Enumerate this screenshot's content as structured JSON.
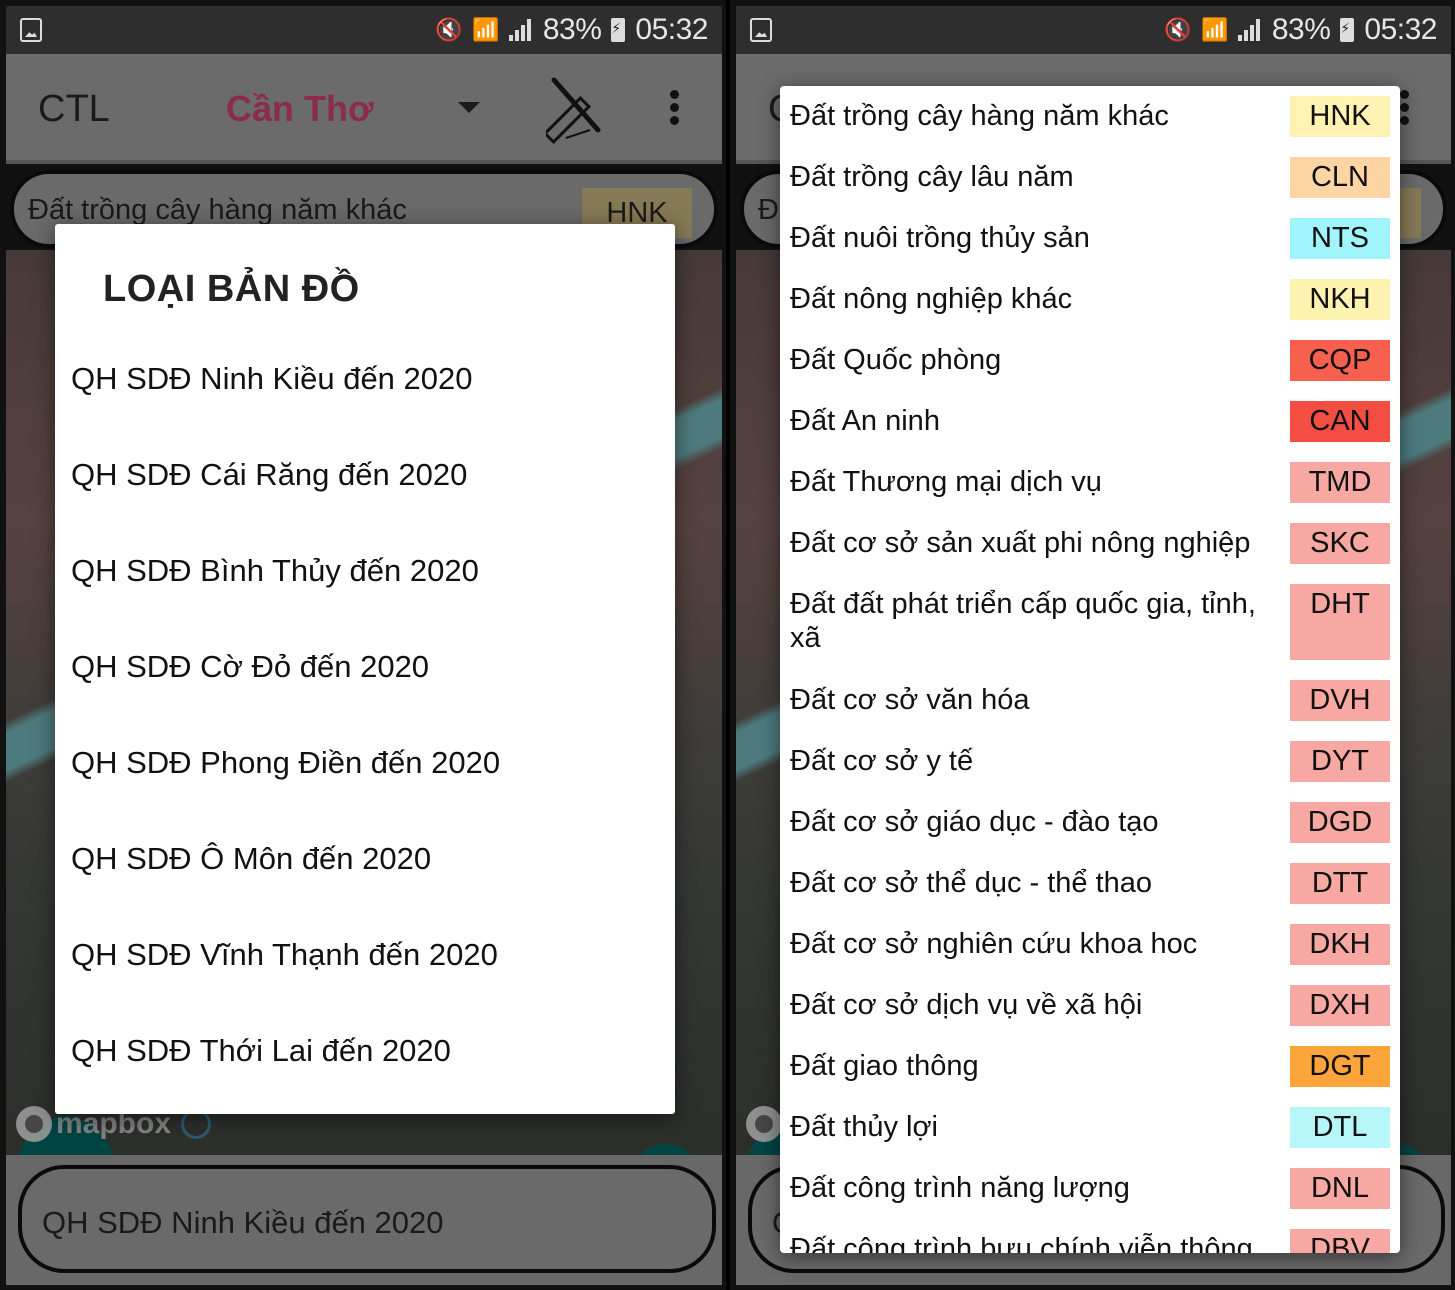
{
  "status_bar": {
    "battery": "83%",
    "time": "05:32",
    "icons": [
      "gallery-notification-icon",
      "mute-vibrate-icon",
      "wifi-icon",
      "signal-icon",
      "battery-charging-icon"
    ]
  },
  "app_bar": {
    "title": "CTL",
    "city": "Cần Thơ",
    "city_color": "#8b2c4a",
    "tool_icon": "ruler-pencil-icon",
    "menu_icon": "more-vert-icon"
  },
  "landuse_field": {
    "name": "Đất trồng cây hàng năm khác",
    "code": "HNK"
  },
  "maptype_field": {
    "value": "QH SDĐ Ninh Kiều đến 2020"
  },
  "map": {
    "attribution": "mapbox"
  },
  "maptype_dialog": {
    "title": "LOẠI BẢN ĐỒ",
    "items": [
      "QH SDĐ Ninh Kiều đến 2020",
      "QH SDĐ Cái Răng đến 2020",
      "QH SDĐ Bình Thủy đến 2020",
      "QH SDĐ Cờ Đỏ đến 2020",
      "QH SDĐ Phong Điền đến 2020",
      "QH SDĐ Ô Môn đến 2020",
      "QH SDĐ Vĩnh Thạnh đến 2020",
      "QH SDĐ Thới Lai đến 2020"
    ]
  },
  "landuse_dialog": {
    "items": [
      {
        "name": "Đất trồng cây hàng năm khác",
        "code": "HNK",
        "color": "#fff2b3"
      },
      {
        "name": "Đất trồng cây lâu năm",
        "code": "CLN",
        "color": "#fdd5a5"
      },
      {
        "name": "Đất nuôi trồng thủy sản",
        "code": "NTS",
        "color": "#9ff5fb"
      },
      {
        "name": "Đất nông nghiệp khác",
        "code": "NKH",
        "color": "#fdf2b0"
      },
      {
        "name": "Đất Quốc phòng",
        "code": "CQP",
        "color": "#f7604f"
      },
      {
        "name": "Đất An ninh",
        "code": "CAN",
        "color": "#f44d43"
      },
      {
        "name": "Đất Thương mại dịch vụ",
        "code": "TMD",
        "color": "#f7a8a3"
      },
      {
        "name": "Đất cơ sở sản xuất phi nông nghiệp",
        "code": "SKC",
        "color": "#f7a8a3"
      },
      {
        "name": "Đất đất phát triển cấp quốc gia, tỉnh, xã",
        "code": "DHT",
        "color": "#f7a8a3"
      },
      {
        "name": "Đất cơ sở văn hóa",
        "code": "DVH",
        "color": "#f7a8a3"
      },
      {
        "name": "Đất cơ sở y tế",
        "code": "DYT",
        "color": "#f7a8a3"
      },
      {
        "name": "Đất cơ sở giáo dục - đào tạo",
        "code": "DGD",
        "color": "#f7a8a3"
      },
      {
        "name": "Đất cơ sở thể dục - thể thao",
        "code": "DTT",
        "color": "#f7a8a3"
      },
      {
        "name": "Đất cơ sở nghiên cứu khoa hoc",
        "code": "DKH",
        "color": "#f7a8a3"
      },
      {
        "name": "Đất cơ sở dịch vụ về xã hội",
        "code": "DXH",
        "color": "#f7a8a3"
      },
      {
        "name": "Đất giao thông",
        "code": "DGT",
        "color": "#fba53a"
      },
      {
        "name": "Đất thủy lợi",
        "code": "DTL",
        "color": "#b6f5f8"
      },
      {
        "name": "Đất công trình năng lượng",
        "code": "DNL",
        "color": "#f7a8a3"
      },
      {
        "name": "Đất công trình bưu chính viễn thông",
        "code": "DBV",
        "color": "#f7a8a3"
      }
    ]
  }
}
